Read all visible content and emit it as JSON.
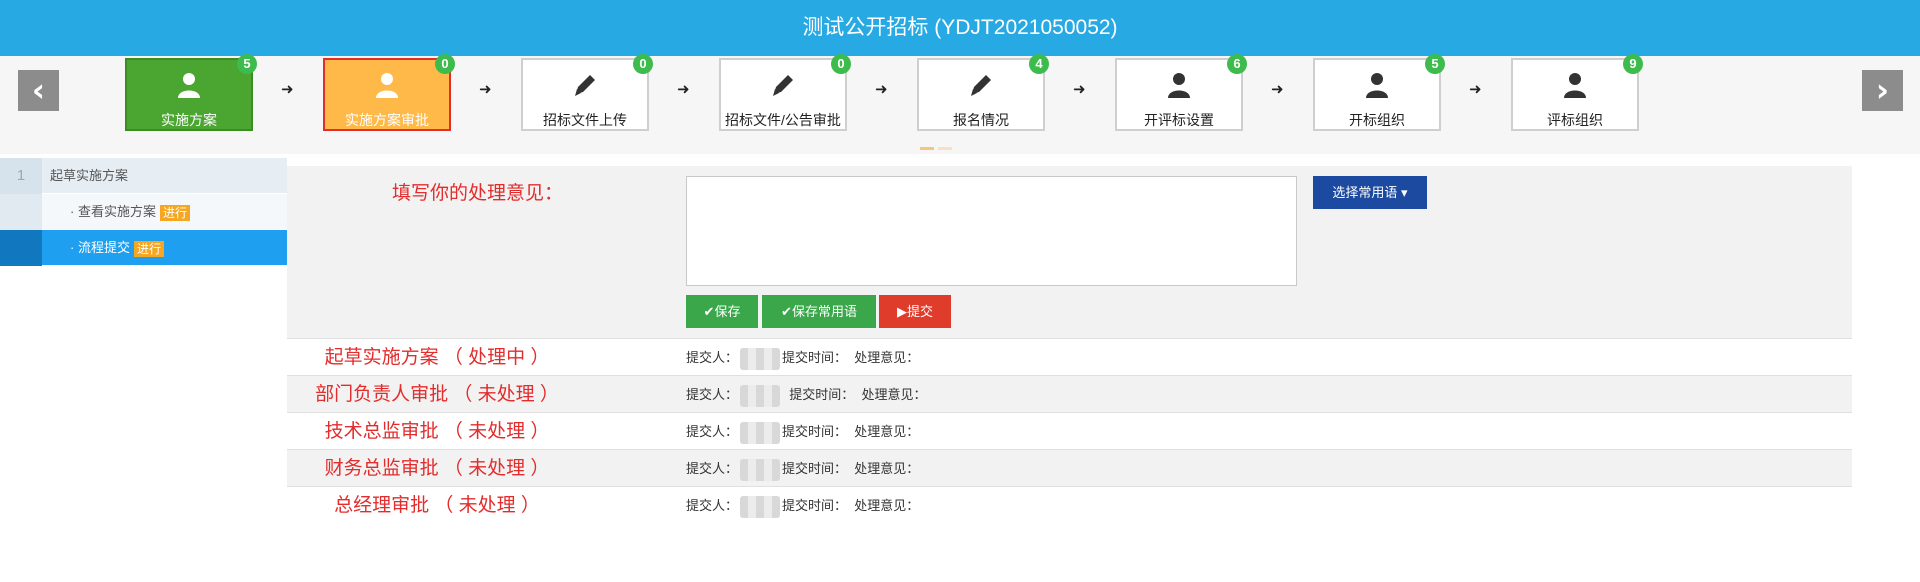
{
  "header": {
    "title": "测试公开招标 (YDJT2021050052)"
  },
  "nav": {
    "prev": "‹",
    "next": "›"
  },
  "steps": [
    {
      "label": "实施方案",
      "badge": "5",
      "icon": "person-icon",
      "state": "done"
    },
    {
      "label": "实施方案审批",
      "badge": "0",
      "icon": "person-icon",
      "state": "active"
    },
    {
      "label": "招标文件上传",
      "badge": "0",
      "icon": "pencil-icon",
      "state": "pending"
    },
    {
      "label": "招标文件/公告审批",
      "badge": "0",
      "icon": "pencil-icon",
      "state": "pending"
    },
    {
      "label": "报名情况",
      "badge": "4",
      "icon": "pencil-icon",
      "state": "pending"
    },
    {
      "label": "开评标设置",
      "badge": "6",
      "icon": "person-icon",
      "state": "pending"
    },
    {
      "label": "开标组织",
      "badge": "5",
      "icon": "person-icon",
      "state": "pending"
    },
    {
      "label": "评标组织",
      "badge": "9",
      "icon": "person-icon",
      "state": "pending"
    }
  ],
  "sidebar": {
    "group_number": "1",
    "group_title": "起草实施方案",
    "items": [
      {
        "label": "· 查看实施方案",
        "tag": "进行"
      },
      {
        "label": "· 流程提交",
        "tag": "进行"
      }
    ]
  },
  "form": {
    "opinion_label": "填写你的处理意见：",
    "opinion_value": "",
    "common_phrases_button": "选择常用语",
    "save_button": "保存",
    "save_common_button": "保存常用语",
    "submit_button": "提交"
  },
  "flow": {
    "submitter_label": "提交人：",
    "time_label": "提交时间：",
    "opinion_label": "处理意见：",
    "rows": [
      {
        "name": "起草实施方案 （ 处理中 ）"
      },
      {
        "name": "部门负责人审批 （ 未处理 ）"
      },
      {
        "name": "技术总监审批 （ 未处理 ）"
      },
      {
        "name": "财务总监审批 （ 未处理 ）"
      },
      {
        "name": "总经理审批 （ 未处理 ）"
      }
    ]
  },
  "colors": {
    "header": "#27a9e3",
    "done": "#4aa630",
    "active": "#feb949",
    "active_border": "#e32c2c",
    "badge": "#3dbb4c",
    "primary_button": "#1b4aa0",
    "save_button": "#3aa84a",
    "submit_button": "#e03c2c"
  }
}
